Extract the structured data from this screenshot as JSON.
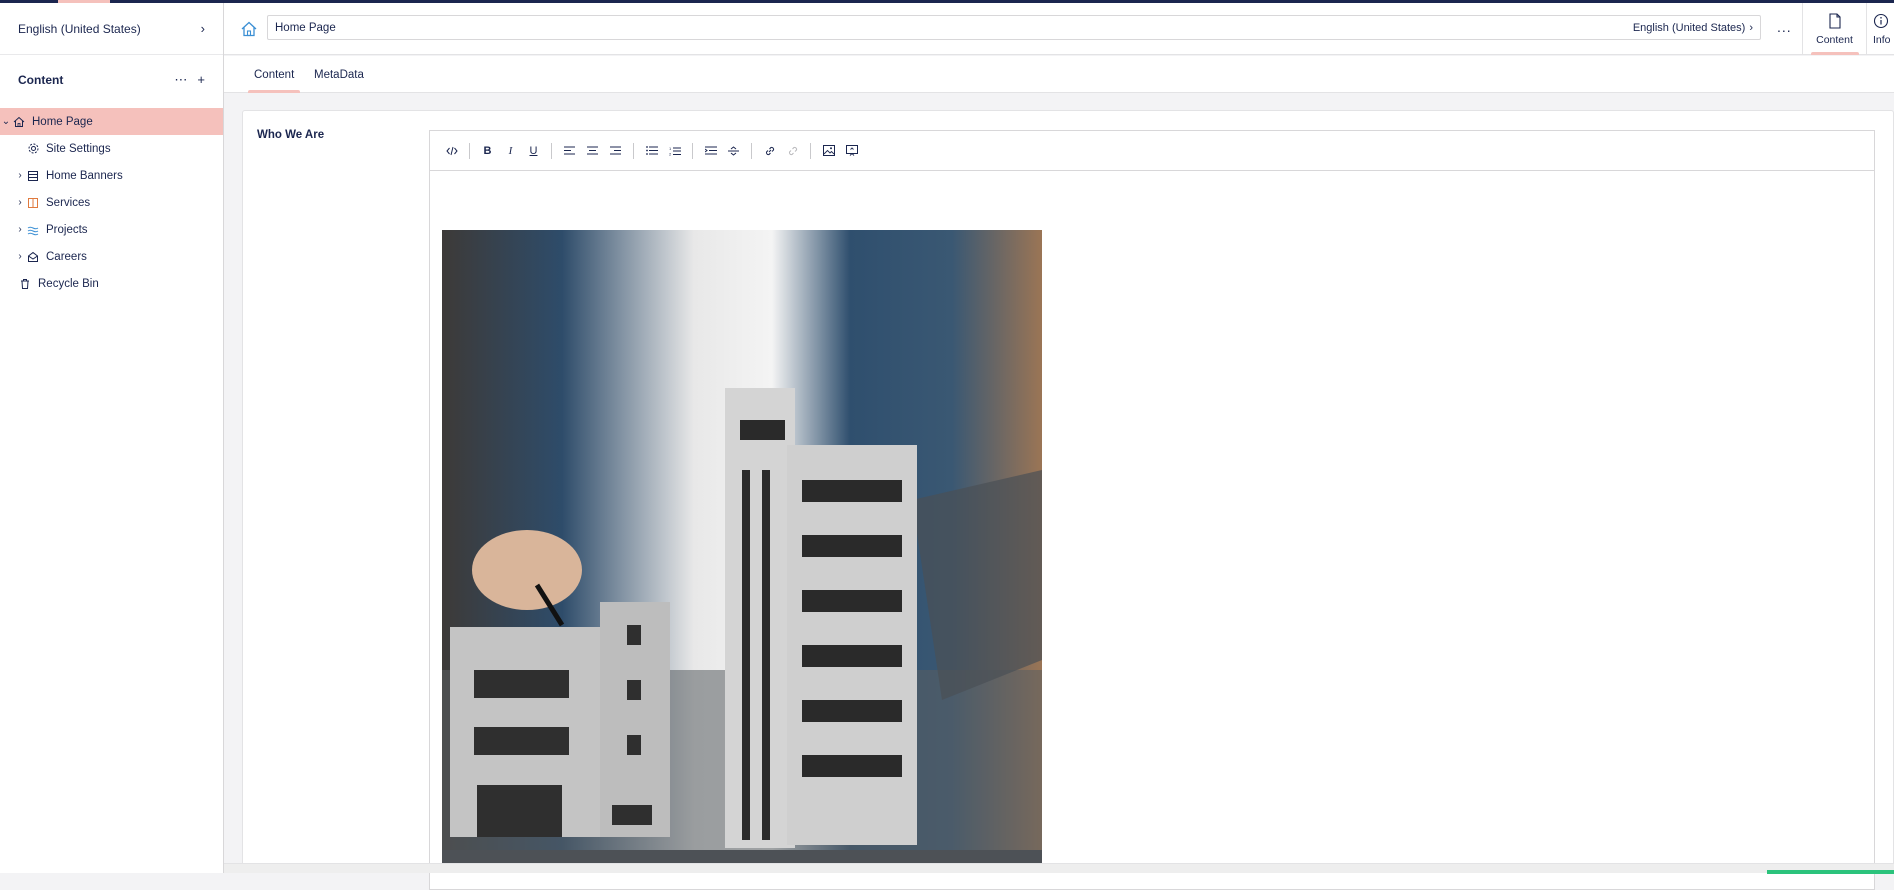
{
  "sidebar": {
    "language": "English (United States)",
    "section_title": "Content",
    "items": [
      {
        "label": "Home Page",
        "icon": "home-icon",
        "expanded": true,
        "active": true
      },
      {
        "label": "Site Settings",
        "icon": "settings-icon"
      },
      {
        "label": "Home Banners",
        "icon": "stack-icon"
      },
      {
        "label": "Services",
        "icon": "book-icon"
      },
      {
        "label": "Projects",
        "icon": "waves-icon"
      },
      {
        "label": "Careers",
        "icon": "inbox-icon"
      },
      {
        "label": "Recycle Bin",
        "icon": "trash-icon"
      }
    ]
  },
  "header": {
    "document_name": "Home Page",
    "variant": "English (United States)",
    "more": "...",
    "apps": [
      {
        "label": "Content",
        "icon": "document-icon"
      },
      {
        "label": "Info",
        "icon": "info-icon"
      }
    ]
  },
  "tabs": [
    {
      "label": "Content",
      "active": true
    },
    {
      "label": "MetaData"
    }
  ],
  "property": {
    "label": "Who We Are"
  },
  "toolbar_buttons": [
    "source-code-icon",
    "bold-icon",
    "italic-icon",
    "underline-icon",
    "align-left-icon",
    "align-center-icon",
    "align-right-icon",
    "bullet-list-icon",
    "numbered-list-icon",
    "indent-icon",
    "strikethrough-icon",
    "link-icon",
    "unlink-icon",
    "image-icon",
    "embed-icon"
  ],
  "colors": {
    "brand_dark": "#1b264f",
    "accent_pink": "#f5c1bc",
    "success_green": "#2bc37c"
  }
}
